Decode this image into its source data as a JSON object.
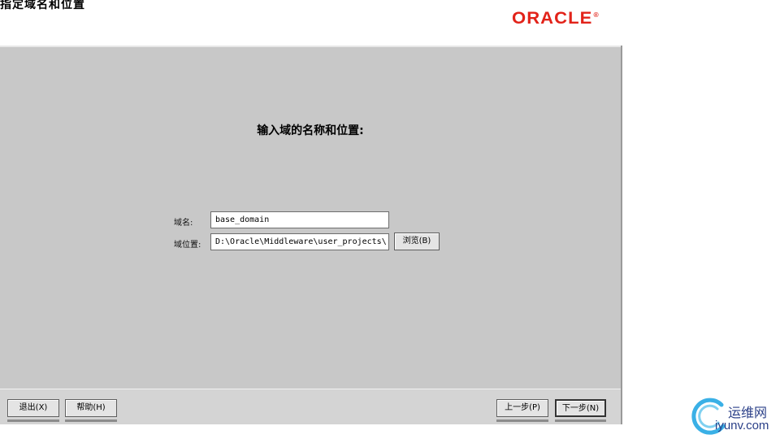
{
  "window": {
    "title": "指定域名和位置",
    "logo": "ORACLE"
  },
  "main": {
    "prompt": "输入域的名称和位置:",
    "domain_name_label": "域名:",
    "domain_name_value": "base_domain",
    "domain_location_label": "域位置:",
    "domain_location_value": "D:\\Oracle\\Middleware\\user_projects\\",
    "browse_button": "浏览(B)"
  },
  "footer": {
    "exit_button": "退出(X)",
    "help_button": "帮助(H)",
    "prev_button": "上一步(P)",
    "next_button": "下一步(N)"
  },
  "watermark": {
    "brand_cn": "运维网",
    "url": "iyunv.com"
  },
  "colors": {
    "panel_bg": "#c8c8c8",
    "logo_red": "#e2231a",
    "watermark_blue": "#2a3f88"
  }
}
